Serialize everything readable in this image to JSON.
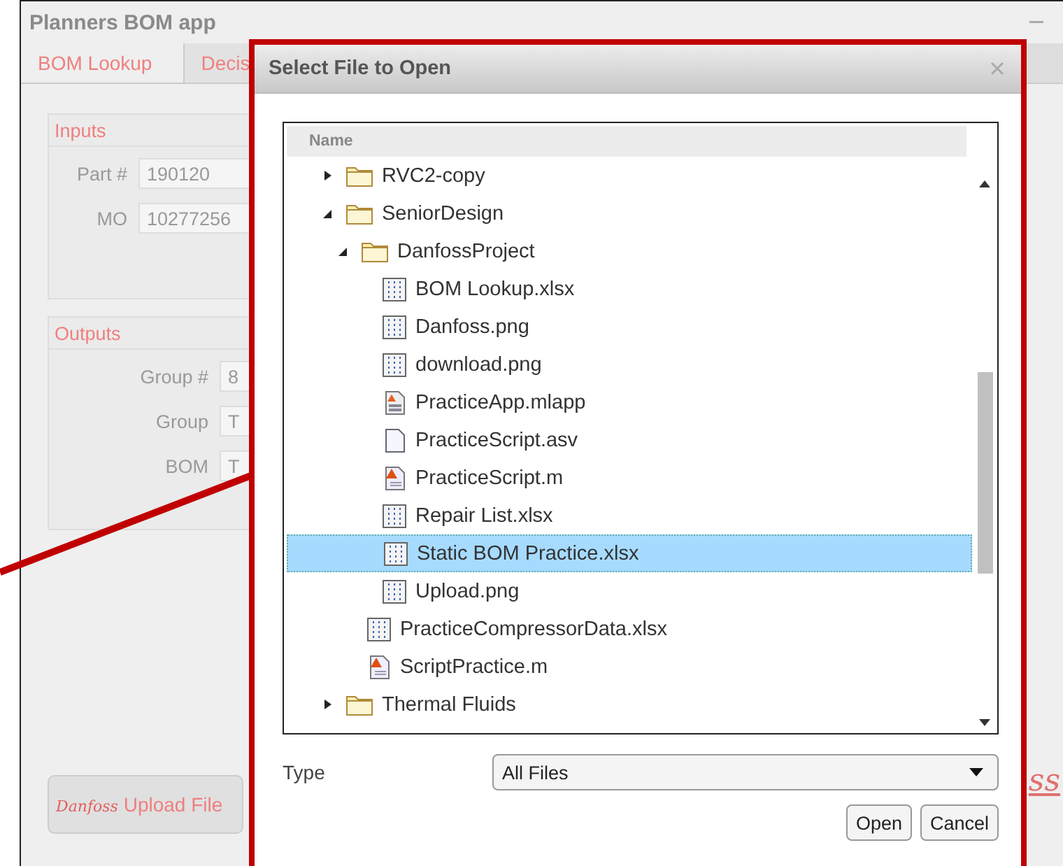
{
  "window": {
    "title": "Planners BOM app"
  },
  "tabs": [
    {
      "label": "BOM Lookup",
      "selected": true
    },
    {
      "label": "Decis",
      "selected": false
    }
  ],
  "inputs": {
    "title": "Inputs",
    "fields": [
      {
        "label": "Part #",
        "value": "190120"
      },
      {
        "label": "MO",
        "value": "10277256"
      }
    ]
  },
  "outputs": {
    "title": "Outputs",
    "fields": [
      {
        "label": "Group #",
        "value": "8"
      },
      {
        "label": "Group",
        "value": "T"
      },
      {
        "label": "BOM",
        "value": "T"
      }
    ]
  },
  "upload_button": {
    "logo": "Danfoss",
    "label": "Upload File"
  },
  "side_logo": "ss",
  "dialog": {
    "title": "Select File to Open",
    "column": "Name",
    "tree": [
      {
        "name": "RVC2-copy",
        "kind": "folder",
        "expanded": false,
        "selected": false
      },
      {
        "name": "SeniorDesign",
        "kind": "folder",
        "expanded": true,
        "selected": false,
        "children": [
          {
            "name": "DanfossProject",
            "kind": "folder",
            "expanded": true,
            "selected": false,
            "children": [
              {
                "name": "BOM Lookup.xlsx",
                "kind": "data",
                "selected": false
              },
              {
                "name": "Danfoss.png",
                "kind": "data",
                "selected": false
              },
              {
                "name": "download.png",
                "kind": "data",
                "selected": false
              },
              {
                "name": "PracticeApp.mlapp",
                "kind": "app",
                "selected": false
              },
              {
                "name": "PracticeScript.asv",
                "kind": "blank",
                "selected": false
              },
              {
                "name": "PracticeScript.m",
                "kind": "script",
                "selected": false
              },
              {
                "name": "Repair List.xlsx",
                "kind": "data",
                "selected": false
              },
              {
                "name": "Static BOM Practice.xlsx",
                "kind": "data",
                "selected": true
              },
              {
                "name": "Upload.png",
                "kind": "data",
                "selected": false
              }
            ]
          },
          {
            "name": "PracticeCompressorData.xlsx",
            "kind": "data",
            "selected": false
          },
          {
            "name": "ScriptPractice.m",
            "kind": "script",
            "selected": false
          }
        ]
      },
      {
        "name": "Thermal Fluids",
        "kind": "folder",
        "expanded": false,
        "selected": false
      }
    ],
    "type_label": "Type",
    "type_value": "All Files",
    "buttons": [
      "Open",
      "Cancel"
    ]
  }
}
